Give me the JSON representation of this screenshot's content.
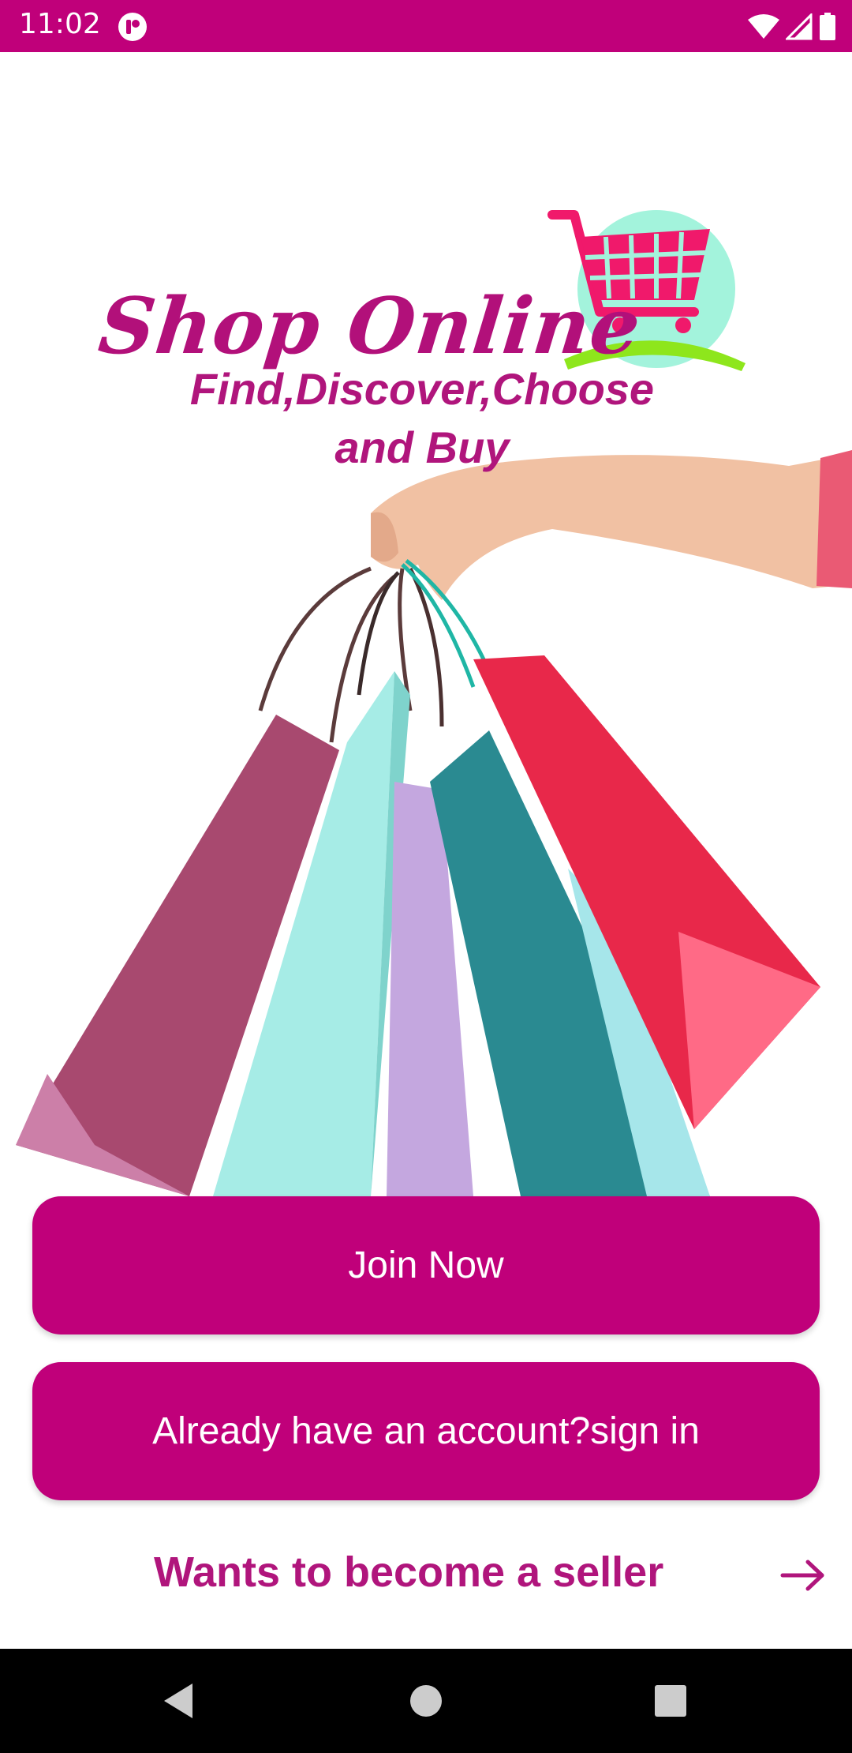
{
  "status_bar": {
    "time": "11:02",
    "icons": [
      "app-notification-icon",
      "wifi-icon",
      "cell-signal-icon",
      "battery-icon"
    ],
    "background": "#c0007a"
  },
  "hero": {
    "brand_title": "Shop Online",
    "tagline": "Find,Discover,Choose\nand Buy",
    "logo_icon": "shopping-cart-icon",
    "image": "hand-holding-shopping-bags"
  },
  "buttons": {
    "join": "Join Now",
    "sign_in": "Already have an account?sign in"
  },
  "seller": {
    "label": "Wants to become a seller",
    "icon": "arrow-right-icon"
  },
  "nav_bar": {
    "icons": [
      "back-icon",
      "home-icon",
      "recents-icon"
    ]
  },
  "colors": {
    "primary": "#c0007a",
    "text_accent": "#b0157c"
  }
}
